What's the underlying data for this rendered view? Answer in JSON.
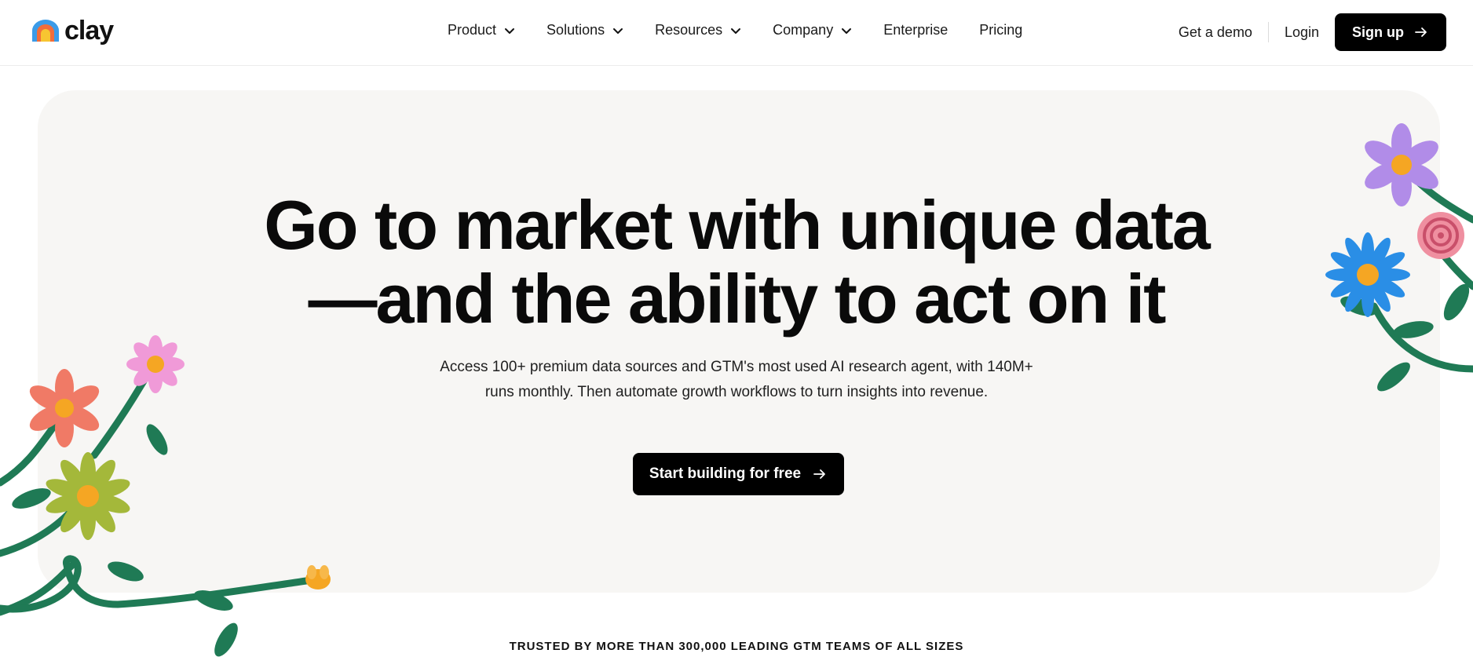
{
  "brand": {
    "name": "clay",
    "logo_icon": "clay-arch-logo-icon",
    "colors": {
      "accent": "#000000",
      "hero_bg": "#f7f6f4"
    }
  },
  "nav": {
    "items": [
      {
        "label": "Product",
        "icon": "chevron-down-icon"
      },
      {
        "label": "Solutions",
        "icon": "chevron-down-icon"
      },
      {
        "label": "Resources",
        "icon": "chevron-down-icon"
      },
      {
        "label": "Company",
        "icon": "chevron-down-icon"
      },
      {
        "label": "Enterprise"
      },
      {
        "label": "Pricing"
      }
    ],
    "get_demo": "Get a demo",
    "login": "Login",
    "signup": "Sign up",
    "signup_icon": "arrow-right-icon"
  },
  "hero": {
    "headline_line1": "Go to market with unique data",
    "headline_line2": "—and the ability to act on it",
    "subtext": "Access 100+ premium data sources and GTM's most used AI research agent, with 140M+ runs monthly. Then automate growth workflows to turn insights into revenue.",
    "cta_label": "Start building for free",
    "cta_icon": "arrow-right-icon"
  },
  "trusted": {
    "label": "TRUSTED BY MORE THAN 300,000 LEADING GTM TEAMS OF ALL SIZES"
  }
}
